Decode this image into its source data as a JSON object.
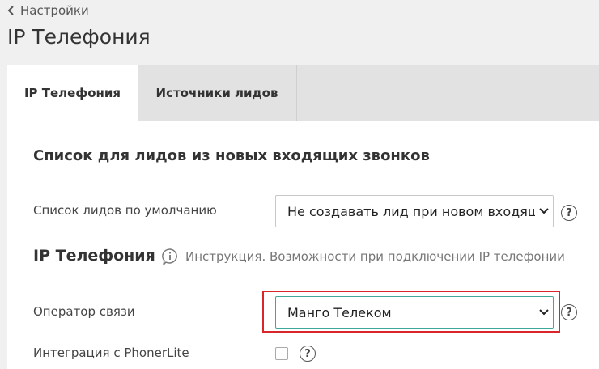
{
  "header": {
    "back_label": "Настройки",
    "title": "IP Телефония"
  },
  "tabs": [
    {
      "label": "IP Телефония",
      "active": true
    },
    {
      "label": "Источники лидов",
      "active": false
    }
  ],
  "leads_section": {
    "heading": "Список для лидов из новых входящих звонков",
    "default_list_label": "Список лидов по умолчанию",
    "default_list_value": "Не создавать лид при новом входящем звонке"
  },
  "telephony_section": {
    "heading": "IP Телефония",
    "instruction_text": "Инструкция. Возможности при подключении IP телефонии",
    "operator_label": "Оператор связи",
    "operator_value": "Манго Телеком",
    "phonerlite_label": "Интеграция с PhonerLite",
    "phonerlite_checked": false
  },
  "help_symbol": "?",
  "colors": {
    "highlight": "#d9262b",
    "focus_border": "#3fa89a",
    "tab_bar": "#e2e2e2",
    "page_bg": "#f0f0f0"
  }
}
